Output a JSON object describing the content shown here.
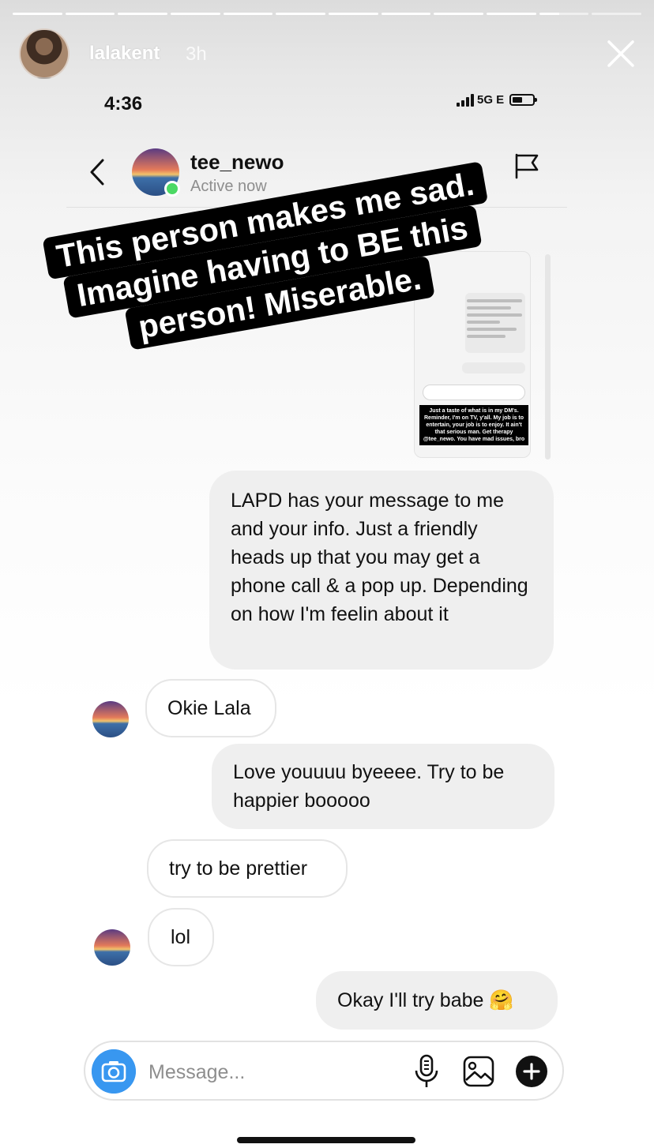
{
  "story": {
    "username": "lalakent",
    "time_ago": "3h",
    "progress_segments": 12,
    "progress_completed": 10,
    "progress_current_fraction": 0.4
  },
  "phone": {
    "time": "4:36",
    "network": "5G E"
  },
  "chat": {
    "username": "tee_newo",
    "status": "Active now"
  },
  "banner": {
    "lines": [
      "This person makes me sad.",
      "Imagine having to BE this",
      "person! Miserable."
    ]
  },
  "embedded_screenshot": {
    "caption": "Just a taste of what is in my DM's. Reminder, I'm on TV, y'all. My job is to entertain, your job is to enjoy. It ain't that serious man. Get therapy @tee_newo. You have mad issues, bro"
  },
  "messages": [
    {
      "side": "out",
      "text": "LAPD has your message to me and your info. Just a friendly heads up that you may get a phone call & a pop up. Depending on how I'm feelin about it"
    },
    {
      "side": "in",
      "text": "Okie Lala"
    },
    {
      "side": "out",
      "text": "Love youuuu byeeee. Try to be happier booooo"
    },
    {
      "side": "in",
      "text": "try to be prettier"
    },
    {
      "side": "in",
      "text": "lol"
    },
    {
      "side": "out",
      "text": "Okay I'll try babe",
      "emoji": "🤗"
    }
  ],
  "composer": {
    "placeholder": "Message..."
  },
  "colors": {
    "accent_blue": "#3897f0",
    "active_green": "#4cd964",
    "bubble_gray": "#efefef"
  }
}
